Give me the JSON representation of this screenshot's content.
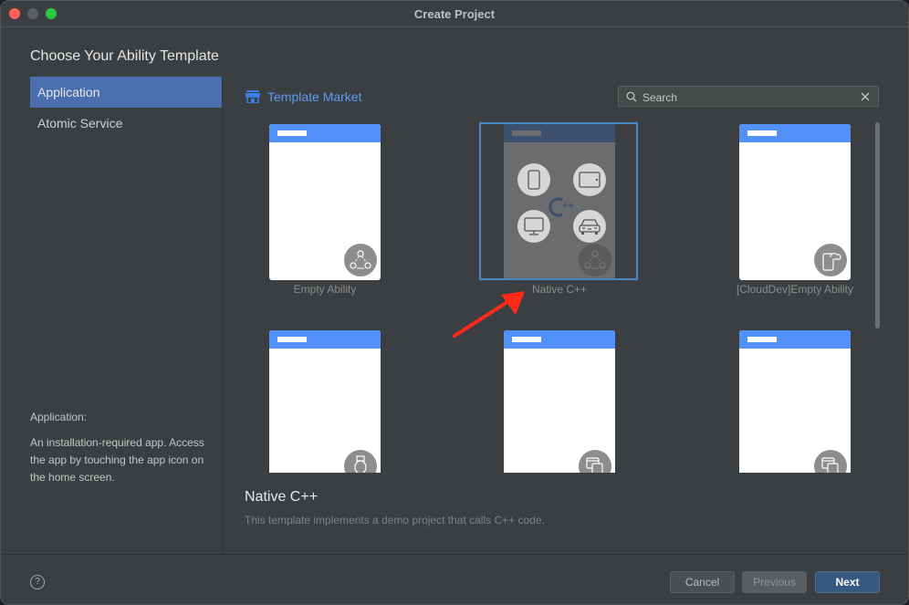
{
  "window": {
    "title": "Create Project"
  },
  "heading": "Choose Your Ability Template",
  "sidebar": {
    "items": [
      {
        "label": "Application",
        "active": true
      },
      {
        "label": "Atomic Service",
        "active": false
      }
    ],
    "description_title": "Application:",
    "description": "An installation-required app. Access the app by touching the app icon on the home screen."
  },
  "main": {
    "market_label": "Template Market",
    "market_icon": "store-icon",
    "search": {
      "value": "",
      "placeholder": "Search",
      "icon": "search-icon",
      "clear_icon": "close-icon"
    },
    "templates": [
      {
        "label": "Empty Ability",
        "badge_icon": "nodes-icon",
        "selected": false
      },
      {
        "label": "Native C++",
        "badge_icon": "nodes-icon",
        "selected": true,
        "center_mark": "C++"
      },
      {
        "label": "[CloudDev]Empty Ability",
        "badge_icon": "cloud-phone-icon",
        "selected": false
      },
      {
        "label": "",
        "badge_icon": "watch-icon",
        "selected": false
      },
      {
        "label": "",
        "badge_icon": "multi-device-icon",
        "selected": false
      },
      {
        "label": "",
        "badge_icon": "multi-device-icon",
        "selected": false
      }
    ],
    "detail": {
      "title": "Native C++",
      "description": "This template implements a demo project that calls C++ code."
    }
  },
  "footer": {
    "help_label": "?",
    "cancel_label": "Cancel",
    "previous_label": "Previous",
    "next_label": "Next"
  },
  "colors": {
    "accent": "#4b6eaf",
    "link": "#589df6",
    "card_header": "#5291f7",
    "selection_border": "#4a88c7",
    "annotation_arrow": "#ff2a1a"
  }
}
